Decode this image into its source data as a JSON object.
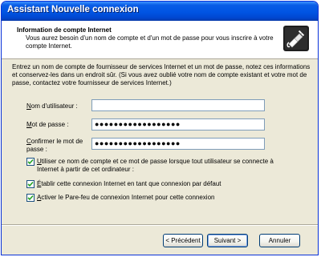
{
  "window": {
    "title": "Assistant Nouvelle connexion"
  },
  "header": {
    "title": "Information de compte Internet",
    "subtitle": "Vous aurez besoin d'un nom de compte et d'un mot de passe pour vous inscrire à votre compte Internet.",
    "icon": "wizard-connection-icon"
  },
  "form": {
    "intro": "Entrez un nom de compte de fournisseur de services Internet et un mot de passe, notez ces informations et conservez-les dans un endroit sûr. (Si vous avez oublié votre nom de compte existant et votre mot de passe, contactez votre fournisseur de services Internet.)",
    "username": {
      "label_u": "N",
      "label_rest": "om d'utilisateur :",
      "value": ""
    },
    "password": {
      "label_u": "M",
      "label_rest": "ot de passe :",
      "value": "●●●●●●●●●●●●●●●●●●"
    },
    "confirm": {
      "label_u": "C",
      "label_rest": "onfirmer le mot de passe :",
      "value": "●●●●●●●●●●●●●●●●●●"
    },
    "checkboxes": [
      {
        "label_u": "U",
        "label_rest": "tiliser ce nom de compte et ce mot de passe lorsque tout utilisateur se connecte à Internet à partir de cet ordinateur :",
        "checked": true
      },
      {
        "label_u": "É",
        "label_rest": "tablir cette connexion Internet en tant que connexion par défaut",
        "checked": true
      },
      {
        "label_u": "A",
        "label_rest": "ctiver le Pare-feu de connexion Internet pour cette connexion",
        "checked": true
      }
    ]
  },
  "buttons": {
    "back": "< Précédent",
    "next": "Suivant >",
    "cancel": "Annuler"
  },
  "colors": {
    "title_bar": "#0054e3",
    "window_bg": "#ece9d8",
    "field_border": "#7f9db9",
    "checkbox_border": "#1c5180",
    "check_mark": "#21a121"
  }
}
